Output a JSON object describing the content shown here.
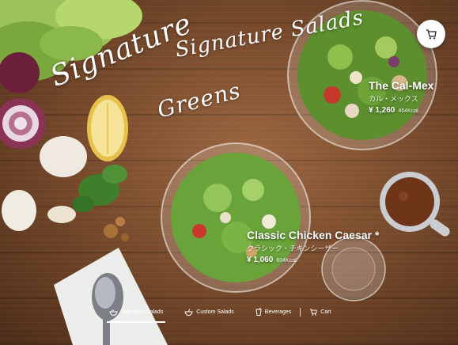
{
  "hero": {
    "title_line1": "Signature Salads",
    "title_line2": "Signature",
    "title_line3": "Greens"
  },
  "header": {
    "cart_icon": "cart-icon"
  },
  "menu_items": [
    {
      "name": "The Cal-Mex",
      "name_ja": "カル・メックス",
      "price": "¥ 1,260",
      "kcal": "464Kcal"
    },
    {
      "name": "Classic Chicken Caesar *",
      "name_ja": "クラシック・チキンシーザー",
      "price": "¥ 1,060",
      "kcal": "604Kcal"
    }
  ],
  "nav": {
    "items": [
      {
        "label": "Signature Salads",
        "icon": "salad-bowl-icon",
        "active": true
      },
      {
        "label": "Custom Salads",
        "icon": "custom-bowl-icon",
        "active": false
      },
      {
        "label": "Beverages",
        "icon": "cup-icon",
        "active": false
      },
      {
        "label": "Cart",
        "icon": "cart-icon",
        "active": false
      }
    ]
  },
  "colors": {
    "wood": "#7a4c2d",
    "text": "#ffffff",
    "lemon": "#f2d36b",
    "lettuce": "#6fae3e"
  }
}
